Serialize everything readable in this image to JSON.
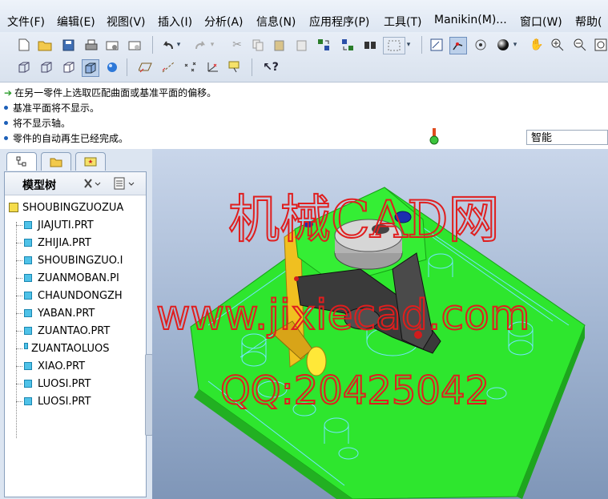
{
  "menu": [
    "文件(F)",
    "编辑(E)",
    "视图(V)",
    "插入(I)",
    "分析(A)",
    "信息(N)",
    "应用程序(P)",
    "工具(T)",
    "Manikin(M)...",
    "窗口(W)",
    "帮助("
  ],
  "messages": [
    {
      "type": "prompt",
      "text": "在另一零件上选取匹配曲面或基准平面的偏移。"
    },
    {
      "type": "info",
      "text": "基准平面将不显示。"
    },
    {
      "type": "info",
      "text": "将不显示轴。"
    },
    {
      "type": "info",
      "text": "零件的自动再生已经完成。"
    }
  ],
  "filter_value": "智能",
  "tree": {
    "title": "模型树",
    "root": "SHOUBINGZUOZUA",
    "items": [
      "JIAJUTI.PRT",
      "ZHIJIA.PRT",
      "SHOUBINGZUO.I",
      "ZUANMOBAN.PI",
      "CHAUNDONGZH",
      "YABAN.PRT",
      "ZUANTAO.PRT",
      "ZUANTAOLUOS",
      "XIAO.PRT",
      "LUOSI.PRT",
      "LUOSI.PRT"
    ]
  },
  "watermark": {
    "line1": "机械CAD网",
    "line2": "www.jixiecad.com",
    "line3": "QQ:20425042"
  },
  "colors": {
    "plate_green": "#2ee62e",
    "watermark_red": "#e01e1e",
    "part_blue": "#4fc2e8",
    "part_yellow": "#f0c020",
    "part_dark": "#3a3a3a"
  }
}
